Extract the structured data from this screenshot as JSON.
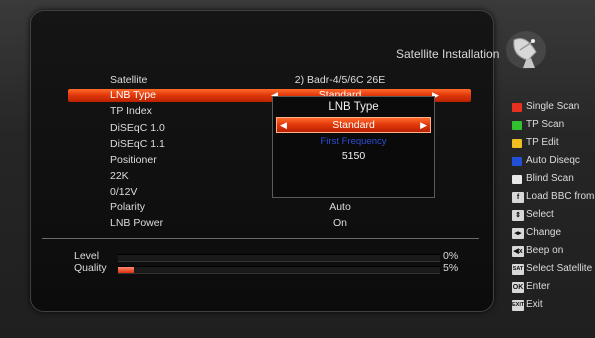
{
  "screen_title": "Satellite Installation",
  "settings": [
    {
      "label": "Satellite",
      "value": "2) Badr-4/5/6C 26E"
    },
    {
      "label": "LNB Type",
      "value": "Standard"
    },
    {
      "label": "TP Index",
      "value": ""
    },
    {
      "label": "DiSEqC 1.0",
      "value": ""
    },
    {
      "label": "DiSEqC 1.1",
      "value": ""
    },
    {
      "label": "Positioner",
      "value": ""
    },
    {
      "label": "22K",
      "value": ""
    },
    {
      "label": "0/12V",
      "value": ""
    },
    {
      "label": "Polarity",
      "value": "Auto"
    },
    {
      "label": "LNB Power",
      "value": "On"
    }
  ],
  "popup": {
    "title": "LNB Type",
    "selected": "Standard",
    "subtitle": "First Frequency",
    "frequency": "5150"
  },
  "meters": {
    "level_label": "Level",
    "level_pct": "0%",
    "level_value": 0,
    "quality_label": "Quality",
    "quality_pct": "5%",
    "quality_value": 5
  },
  "legend": [
    {
      "color": "#e83020",
      "icon": "red-key",
      "label": "Single Scan"
    },
    {
      "color": "#30c030",
      "icon": "green-key",
      "label": "TP Scan"
    },
    {
      "color": "#f0c020",
      "icon": "yellow-key",
      "label": "TP Edit"
    },
    {
      "color": "#2050d8",
      "icon": "blue-key",
      "label": "Auto Diseqc"
    },
    {
      "color": "#e8e8e8",
      "icon": "white-key",
      "label": "Blind Scan"
    },
    {
      "key": "f",
      "icon": "f-key",
      "label": "Load BBC from"
    },
    {
      "key": "⇕",
      "icon": "up-down-key",
      "label": "Select"
    },
    {
      "key": "◂▸",
      "icon": "left-right-key",
      "label": "Change"
    },
    {
      "key": "◀x",
      "icon": "mute-key",
      "label": "Beep on"
    },
    {
      "key": "SAT",
      "icon": "sat-key",
      "label": "Select Satellite"
    },
    {
      "key": "OK",
      "icon": "ok-key",
      "label": "Enter"
    },
    {
      "key": "EXIT",
      "icon": "exit-key",
      "label": "Exit"
    }
  ]
}
